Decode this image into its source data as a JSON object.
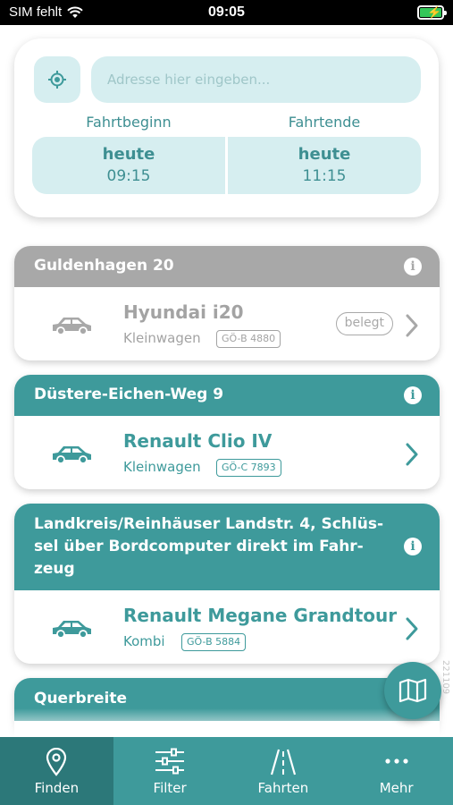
{
  "status_bar": {
    "carrier": "SIM fehlt",
    "time": "09:05"
  },
  "search": {
    "address_placeholder": "Adresse hier eingeben...",
    "start_label": "Fahrtbeginn",
    "end_label": "Fahrtende",
    "start_day": "heute",
    "start_time": "09:15",
    "end_day": "heute",
    "end_time": "11:15"
  },
  "stations": [
    {
      "name": "Guldenhagen 20",
      "car": "Hyundai i20",
      "car_class": "Kleinwagen",
      "plate": "GÖ-B 4880",
      "status": "belegt"
    },
    {
      "name": "Düstere-Eichen-Weg 9",
      "car": "Renault Clio IV",
      "car_class": "Kleinwagen",
      "plate": "GÖ-C 7893"
    },
    {
      "name_lines": [
        "Landkreis/Reinhäuser Landstr. 4, Schlüs-",
        "sel über Bordcomputer direkt im Fahr-",
        "zeug"
      ],
      "car": "Renault Megane Grandtour",
      "car_class": "Kombi",
      "plate": "GÖ-B 5884"
    },
    {
      "name": "Querbreite"
    }
  ],
  "side_code": "221109",
  "tabs": [
    {
      "label": "Finden",
      "icon": "map-pin-icon",
      "active": true
    },
    {
      "label": "Filter",
      "icon": "sliders-icon",
      "active": false
    },
    {
      "label": "Fahrten",
      "icon": "road-icon",
      "active": false
    },
    {
      "label": "Mehr",
      "icon": "more-dots-icon",
      "active": false
    }
  ],
  "colors": {
    "accent": "#3e9a9b",
    "accent_light": "#d6eef0",
    "disabled": "#a8a8a8"
  }
}
